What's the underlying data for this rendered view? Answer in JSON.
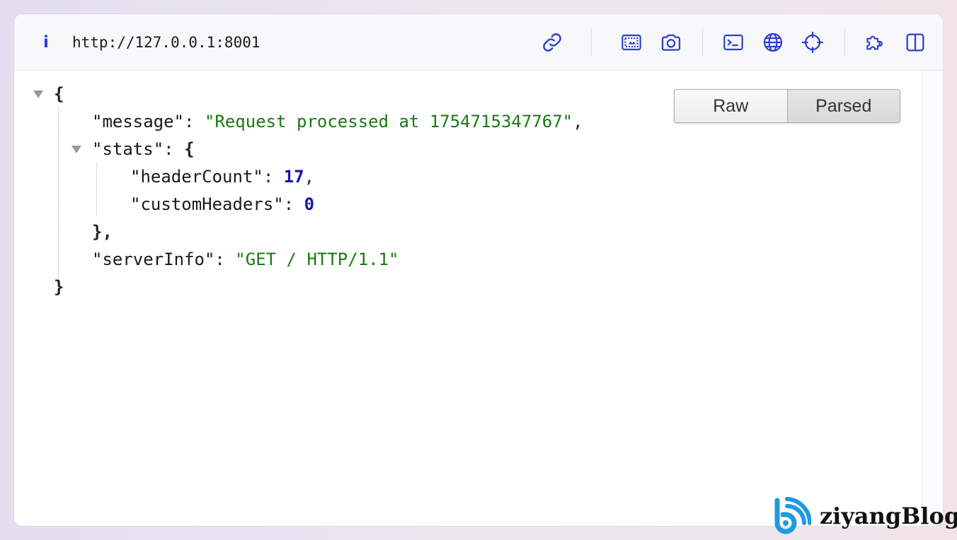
{
  "toolbar": {
    "url": "http://127.0.0.1:8001",
    "icons": [
      "info-icon",
      "link-icon",
      "screenshot-region-icon",
      "camera-icon",
      "terminal-icon",
      "globe-icon",
      "crosshair-icon",
      "puzzle-icon",
      "sidebar-icon"
    ],
    "accent_color": "#2a3fd1"
  },
  "view_toggle": {
    "raw_label": "Raw",
    "parsed_label": "Parsed",
    "selected": "Parsed"
  },
  "json_view": {
    "open_brace": "{",
    "close_brace": "}",
    "message_key": "\"message\"",
    "message_value": "\"Request processed at 1754715347767\"",
    "stats_key": "\"stats\"",
    "stats_open": "{",
    "stats_close": "},",
    "headerCount_key": "\"headerCount\"",
    "headerCount_value": "17",
    "customHeaders_key": "\"customHeaders\"",
    "customHeaders_value": "0",
    "serverInfo_key": "\"serverInfo\"",
    "serverInfo_value": "\"GET / HTTP/1.1\"",
    "colors": {
      "string": "#1a7a12",
      "number": "#1a17a3"
    }
  },
  "watermark": {
    "text": "ziyangBlog",
    "color": "#1e9be0"
  }
}
